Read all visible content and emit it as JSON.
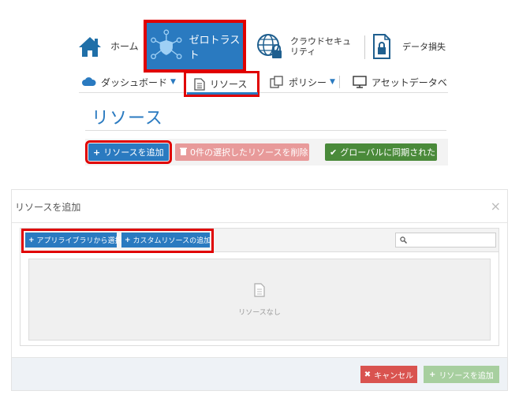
{
  "topnav": {
    "home_label": "ホーム",
    "zerotrust_label": "ゼロトラスト",
    "cloud_label": "クラウドセキュリティ",
    "data_label": "データ損失"
  },
  "subnav": {
    "dashboard_label": "ダッシュボード",
    "resources_label": "リソース",
    "policy_label": "ポリシー",
    "asset_label": "アセットデータベ"
  },
  "page": {
    "title": "リソース"
  },
  "actions": {
    "add_resource": "リソースを追加",
    "delete_selected": "0件の選択したリソースを削除",
    "sync_global": "グローバルに同期された"
  },
  "modal": {
    "title": "リソースを追加",
    "close": "×",
    "select_from_library": "アプリライブラリから選択",
    "add_custom_resource": "カスタムリソースの追加",
    "search_placeholder": "",
    "empty_text": "リソースなし",
    "cancel_label": "キャンセル",
    "add_label": "リソースを追加"
  },
  "icons": {
    "home": "home-icon",
    "zerotrust": "shield-network-icon",
    "cloud": "globe-lock-icon",
    "data": "file-lock-icon",
    "dashboard": "cloud-icon",
    "resources": "document-icon",
    "policy": "copy-icon",
    "asset": "monitor-icon",
    "search": "search-icon",
    "empty": "document-icon"
  },
  "colors": {
    "primary": "#2a7ac0",
    "highlight": "#e00000",
    "danger_muted": "#e89a9a",
    "success": "#4a8a3a",
    "cancel": "#d9534f",
    "add_disabled": "#a7cf9f"
  }
}
